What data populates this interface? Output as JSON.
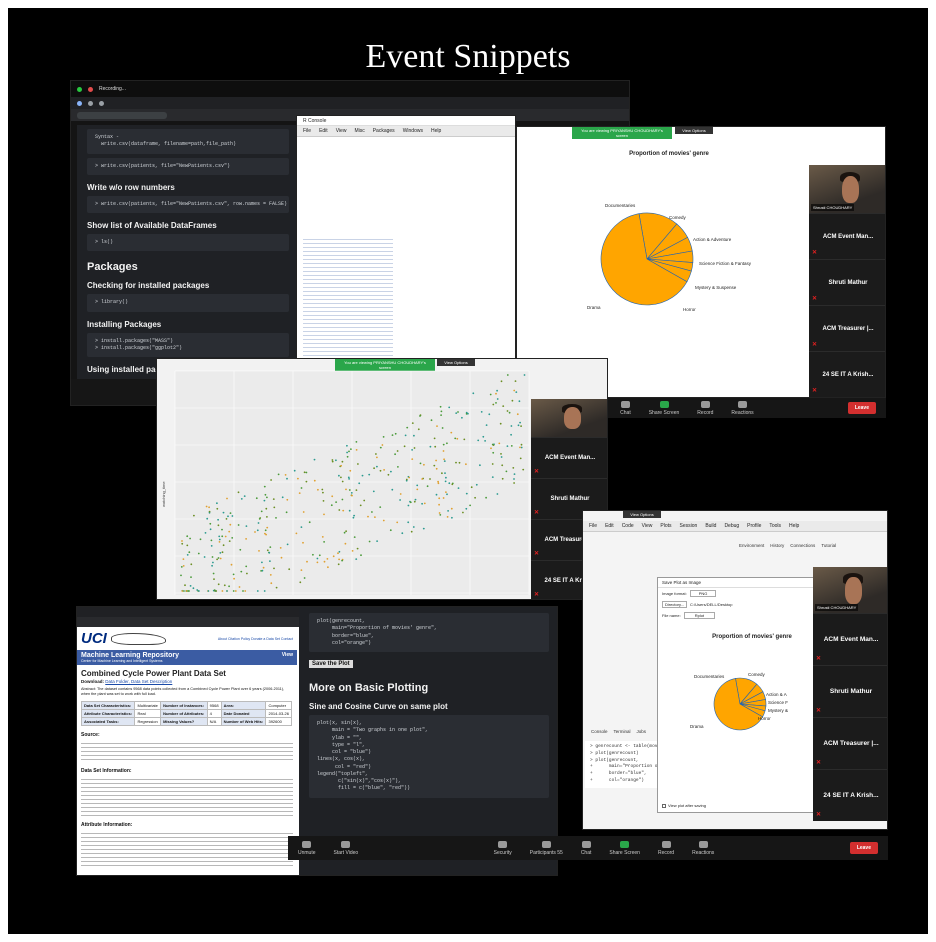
{
  "page": {
    "title": "Event Snippets"
  },
  "zoom": {
    "participants": [
      "ACM Event Man...",
      "Shruti Mathur",
      "ACM Treasurer |...",
      "24 SE IT A Krish..."
    ],
    "camera_label": "Shrusti CHOUDHARY",
    "green_banner": "You are viewing PRIYANSHU CHOUDHARY's screen",
    "view_options": "View Options",
    "toolbar": {
      "unmute": "Unmute",
      "start_video": "Start Video",
      "security": "Security",
      "participants": "Participants",
      "participants_count": "55",
      "chat": "Chat",
      "share_screen": "Share Screen",
      "record": "Record",
      "reactions": "Reactions",
      "leave": "Leave"
    }
  },
  "top_window": {
    "recording": "Recording..."
  },
  "notebook_top": {
    "code1": "Syntax -\n  write.csv(dataframe, filename=path,file_path)",
    "code2": "> write.csv(patients, file=\"NewPatients.csv\")",
    "h_write_wo": "Write w/o row numbers",
    "code3": "> write.csv(patients, file=\"NewPatients.csv\", row.names = FALSE)",
    "h_show_list": "Show list of Available DataFrames",
    "code4": "> ls()",
    "h_packages": "Packages",
    "h_checking": "Checking for installed packages",
    "code5": "> library()",
    "h_installing": "Installing Packages",
    "code6": "> install.packages(\"MASS\")\n> install.packages(\"ggplot2\")",
    "h_using": "Using installed packages"
  },
  "chart_top": {
    "title": "Proportion of movies' genre",
    "labels": [
      "Documentaries",
      "Comedy",
      "Action & Adventure",
      "Science Fiction & Fantasy",
      "Mystery & Suspense",
      "Horror",
      "Drama"
    ],
    "color": "#FFA500",
    "border": "#1E63B5"
  },
  "chart_scatter": {
    "ylabel": "watching_time"
  },
  "uci_page": {
    "logo": "UCI",
    "repo": "Machine Learning Repository",
    "center": "Center for Machine Learning and Intelligent Systems",
    "links": "About  Citation Policy  Donate a Data Set  Contact",
    "view": "View",
    "title": "Combined Cycle Power Plant Data Set",
    "subtitle_label": "Download:",
    "subtitle_links": "Data Folder, Data Set Description",
    "abstract": "Abstract: The dataset contains 9568 data points collected from a Combined Cycle Power Plant over 6 years (2006-2011), when the plant was set to work with full load.",
    "table": [
      [
        "Data Set Characteristics:",
        "Multivariate",
        "Number of Instances:",
        "9568",
        "Area:",
        "Computer"
      ],
      [
        "Attribute Characteristics:",
        "Real",
        "Number of Attributes:",
        "4",
        "Date Donated",
        "2014-03-26"
      ],
      [
        "Associated Tasks:",
        "Regression",
        "Missing Values?",
        "N/A",
        "Number of Web Hits:",
        "392600"
      ]
    ],
    "source_h": "Source:",
    "info_h": "Data Set Information:",
    "attr_h": "Attribute Information:"
  },
  "notebook_bottom": {
    "code1": "plot(genrecount,\n     main=\"Proportion of movies' genre\",\n     border=\"blue\",\n     col=\"orange\")",
    "save": "Save the Plot",
    "h_more": "More on Basic Plotting",
    "h_sine": "Sine and Cosine Curve on same plot",
    "code2": "plot(x, sin(x),\n     main = \"Two graphs in one plot\",\n     ylab = \"\",\n     type = \"l\",\n     col = \"blue\")\nlines(x, cos(x),\n      col = \"red\")\nlegend(\"topleft\",\n       c(\"sin(x)\",\"cos(x)\"),\n       fill = c(\"blue\", \"red\"))"
  },
  "rstudio": {
    "menu": [
      "File",
      "Edit",
      "Code",
      "View",
      "Plots",
      "Session",
      "Build",
      "Debug",
      "Profile",
      "Tools",
      "Help"
    ],
    "env_tabs": [
      "Environment",
      "History",
      "Connections",
      "Tutorial"
    ],
    "console_tabs": [
      "Console",
      "Terminal",
      "Jobs"
    ],
    "export_title": "Save Plot as Image",
    "image_format_label": "Image format:",
    "image_format": "PNG",
    "directory_label": "Directory...",
    "directory": "C:/Users/DELL/Desktop",
    "file_name_label": "File name:",
    "file_name": "Rplot",
    "width_label": "Width:",
    "width": "462",
    "chart_title": "Proportion of movies' genre",
    "pie_labels": [
      "Documentaries",
      "Comedy",
      "Action & A",
      "Science F",
      "Mystery &",
      "Horror",
      "Drama"
    ],
    "view_after": "View plot after saving",
    "save_btn": "Save",
    "code": "> genrecount <- table(movies$genre)\n> plot(genrecount)\n> plot(genrecount,\n+      main=\"Proportion of movies' genre\",\n+      border=\"blue\",\n+      col=\"orange\")"
  },
  "r_console_mid": {
    "title": "R Console",
    "menu": [
      "File",
      "Edit",
      "View",
      "Misc",
      "Packages",
      "Windows",
      "Help"
    ]
  }
}
